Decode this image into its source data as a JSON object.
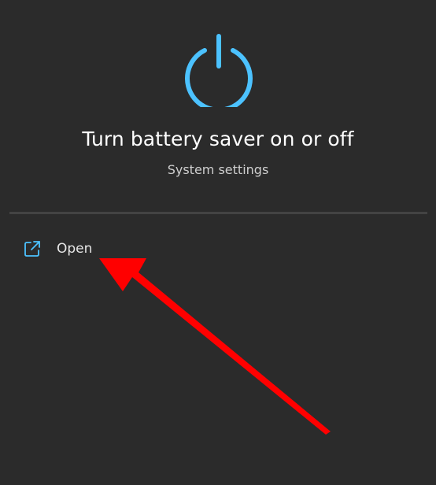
{
  "hero": {
    "icon": "power-icon",
    "title": "Turn battery saver on or off",
    "subtitle": "System settings"
  },
  "actions": {
    "open": {
      "icon": "open-external-icon",
      "label": "Open"
    }
  },
  "colors": {
    "background": "#2b2b2b",
    "accent": "#4cc2ff",
    "divider": "#434343",
    "annotation": "#ff0000"
  }
}
